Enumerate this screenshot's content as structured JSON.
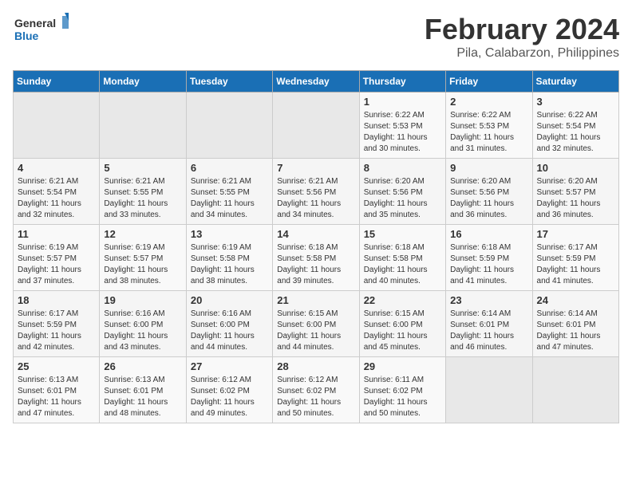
{
  "logo": {
    "line1": "General",
    "line2": "Blue"
  },
  "title": "February 2024",
  "subtitle": "Pila, Calabarzon, Philippines",
  "days_of_week": [
    "Sunday",
    "Monday",
    "Tuesday",
    "Wednesday",
    "Thursday",
    "Friday",
    "Saturday"
  ],
  "weeks": [
    [
      {
        "day": "",
        "info": ""
      },
      {
        "day": "",
        "info": ""
      },
      {
        "day": "",
        "info": ""
      },
      {
        "day": "",
        "info": ""
      },
      {
        "day": "1",
        "info": "Sunrise: 6:22 AM\nSunset: 5:53 PM\nDaylight: 11 hours\nand 30 minutes."
      },
      {
        "day": "2",
        "info": "Sunrise: 6:22 AM\nSunset: 5:53 PM\nDaylight: 11 hours\nand 31 minutes."
      },
      {
        "day": "3",
        "info": "Sunrise: 6:22 AM\nSunset: 5:54 PM\nDaylight: 11 hours\nand 32 minutes."
      }
    ],
    [
      {
        "day": "4",
        "info": "Sunrise: 6:21 AM\nSunset: 5:54 PM\nDaylight: 11 hours\nand 32 minutes."
      },
      {
        "day": "5",
        "info": "Sunrise: 6:21 AM\nSunset: 5:55 PM\nDaylight: 11 hours\nand 33 minutes."
      },
      {
        "day": "6",
        "info": "Sunrise: 6:21 AM\nSunset: 5:55 PM\nDaylight: 11 hours\nand 34 minutes."
      },
      {
        "day": "7",
        "info": "Sunrise: 6:21 AM\nSunset: 5:56 PM\nDaylight: 11 hours\nand 34 minutes."
      },
      {
        "day": "8",
        "info": "Sunrise: 6:20 AM\nSunset: 5:56 PM\nDaylight: 11 hours\nand 35 minutes."
      },
      {
        "day": "9",
        "info": "Sunrise: 6:20 AM\nSunset: 5:56 PM\nDaylight: 11 hours\nand 36 minutes."
      },
      {
        "day": "10",
        "info": "Sunrise: 6:20 AM\nSunset: 5:57 PM\nDaylight: 11 hours\nand 36 minutes."
      }
    ],
    [
      {
        "day": "11",
        "info": "Sunrise: 6:19 AM\nSunset: 5:57 PM\nDaylight: 11 hours\nand 37 minutes."
      },
      {
        "day": "12",
        "info": "Sunrise: 6:19 AM\nSunset: 5:57 PM\nDaylight: 11 hours\nand 38 minutes."
      },
      {
        "day": "13",
        "info": "Sunrise: 6:19 AM\nSunset: 5:58 PM\nDaylight: 11 hours\nand 38 minutes."
      },
      {
        "day": "14",
        "info": "Sunrise: 6:18 AM\nSunset: 5:58 PM\nDaylight: 11 hours\nand 39 minutes."
      },
      {
        "day": "15",
        "info": "Sunrise: 6:18 AM\nSunset: 5:58 PM\nDaylight: 11 hours\nand 40 minutes."
      },
      {
        "day": "16",
        "info": "Sunrise: 6:18 AM\nSunset: 5:59 PM\nDaylight: 11 hours\nand 41 minutes."
      },
      {
        "day": "17",
        "info": "Sunrise: 6:17 AM\nSunset: 5:59 PM\nDaylight: 11 hours\nand 41 minutes."
      }
    ],
    [
      {
        "day": "18",
        "info": "Sunrise: 6:17 AM\nSunset: 5:59 PM\nDaylight: 11 hours\nand 42 minutes."
      },
      {
        "day": "19",
        "info": "Sunrise: 6:16 AM\nSunset: 6:00 PM\nDaylight: 11 hours\nand 43 minutes."
      },
      {
        "day": "20",
        "info": "Sunrise: 6:16 AM\nSunset: 6:00 PM\nDaylight: 11 hours\nand 44 minutes."
      },
      {
        "day": "21",
        "info": "Sunrise: 6:15 AM\nSunset: 6:00 PM\nDaylight: 11 hours\nand 44 minutes."
      },
      {
        "day": "22",
        "info": "Sunrise: 6:15 AM\nSunset: 6:00 PM\nDaylight: 11 hours\nand 45 minutes."
      },
      {
        "day": "23",
        "info": "Sunrise: 6:14 AM\nSunset: 6:01 PM\nDaylight: 11 hours\nand 46 minutes."
      },
      {
        "day": "24",
        "info": "Sunrise: 6:14 AM\nSunset: 6:01 PM\nDaylight: 11 hours\nand 47 minutes."
      }
    ],
    [
      {
        "day": "25",
        "info": "Sunrise: 6:13 AM\nSunset: 6:01 PM\nDaylight: 11 hours\nand 47 minutes."
      },
      {
        "day": "26",
        "info": "Sunrise: 6:13 AM\nSunset: 6:01 PM\nDaylight: 11 hours\nand 48 minutes."
      },
      {
        "day": "27",
        "info": "Sunrise: 6:12 AM\nSunset: 6:02 PM\nDaylight: 11 hours\nand 49 minutes."
      },
      {
        "day": "28",
        "info": "Sunrise: 6:12 AM\nSunset: 6:02 PM\nDaylight: 11 hours\nand 50 minutes."
      },
      {
        "day": "29",
        "info": "Sunrise: 6:11 AM\nSunset: 6:02 PM\nDaylight: 11 hours\nand 50 minutes."
      },
      {
        "day": "",
        "info": ""
      },
      {
        "day": "",
        "info": ""
      }
    ]
  ]
}
